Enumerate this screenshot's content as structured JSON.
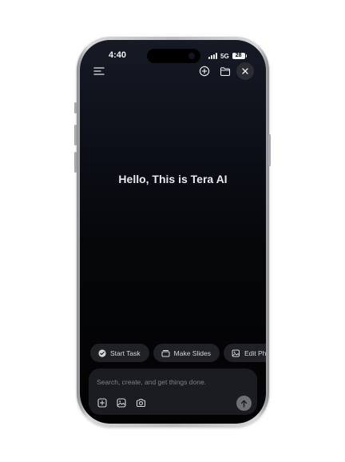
{
  "status_bar": {
    "time": "4:40",
    "network": "5G",
    "battery": "28"
  },
  "toolbar": {
    "icons": [
      "menu-icon",
      "new-chat-icon",
      "folder-icon",
      "close-icon"
    ]
  },
  "main": {
    "greeting": "Hello, This is Tera AI"
  },
  "suggestions": [
    {
      "label": "Start Task",
      "icon": "check-circle-icon"
    },
    {
      "label": "Make Slides",
      "icon": "slides-icon"
    },
    {
      "label": "Edit Ph",
      "icon": "photo-edit-icon"
    }
  ],
  "composer": {
    "placeholder": "Search, create, and get things done.",
    "tools": [
      "add-file-icon",
      "image-icon",
      "camera-icon",
      "send-arrow-icon"
    ]
  },
  "colors": {
    "screen_bg": "#050608",
    "chip_bg": "#1f2125",
    "composer_bg": "#1b1c20",
    "text_primary": "#e9e9ec",
    "placeholder": "#7d7f86"
  }
}
